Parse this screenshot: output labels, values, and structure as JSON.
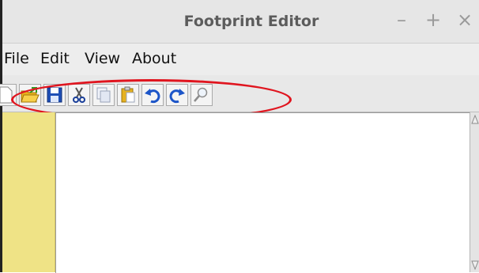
{
  "window": {
    "title": "Footprint Editor",
    "controls": {
      "minimize": "–",
      "maximize": "+",
      "close": "×"
    }
  },
  "menu": {
    "items": [
      "File",
      "Edit",
      "View",
      "About"
    ]
  },
  "toolbar": {
    "buttons": [
      {
        "name": "new",
        "icon": "new-file-icon"
      },
      {
        "name": "open",
        "icon": "open-folder-icon"
      },
      {
        "name": "save",
        "icon": "save-icon"
      },
      {
        "name": "cut",
        "icon": "scissors-icon"
      },
      {
        "name": "copy",
        "icon": "copy-icon"
      },
      {
        "name": "paste",
        "icon": "paste-icon"
      },
      {
        "name": "undo",
        "icon": "undo-icon"
      },
      {
        "name": "redo",
        "icon": "redo-icon"
      },
      {
        "name": "find",
        "icon": "magnifier-icon"
      }
    ]
  },
  "colors": {
    "annotation_circle": "#e0151f",
    "gutter": "#efe386",
    "save_blue": "#1f4fb5",
    "undo_blue": "#1c55c8"
  }
}
